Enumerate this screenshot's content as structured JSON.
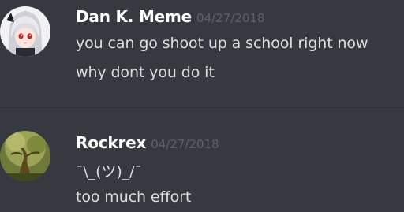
{
  "messages": [
    {
      "author": "Dan K. Meme",
      "timestamp": "04/27/2018",
      "lines": [
        "you can go shoot up a school right now",
        "why dont you do it"
      ],
      "avatar_icon": "anime-girl-avatar-icon"
    },
    {
      "author": "Rockrex",
      "timestamp": "04/27/2018",
      "lines": [
        "¯\\_(ツ)_/¯",
        "too much effort"
      ],
      "avatar_icon": "tree-avatar-icon"
    }
  ],
  "colors": {
    "background": "#36393f",
    "username": "#ffffff",
    "timestamp": "#5f6268",
    "text": "#dcddde"
  }
}
